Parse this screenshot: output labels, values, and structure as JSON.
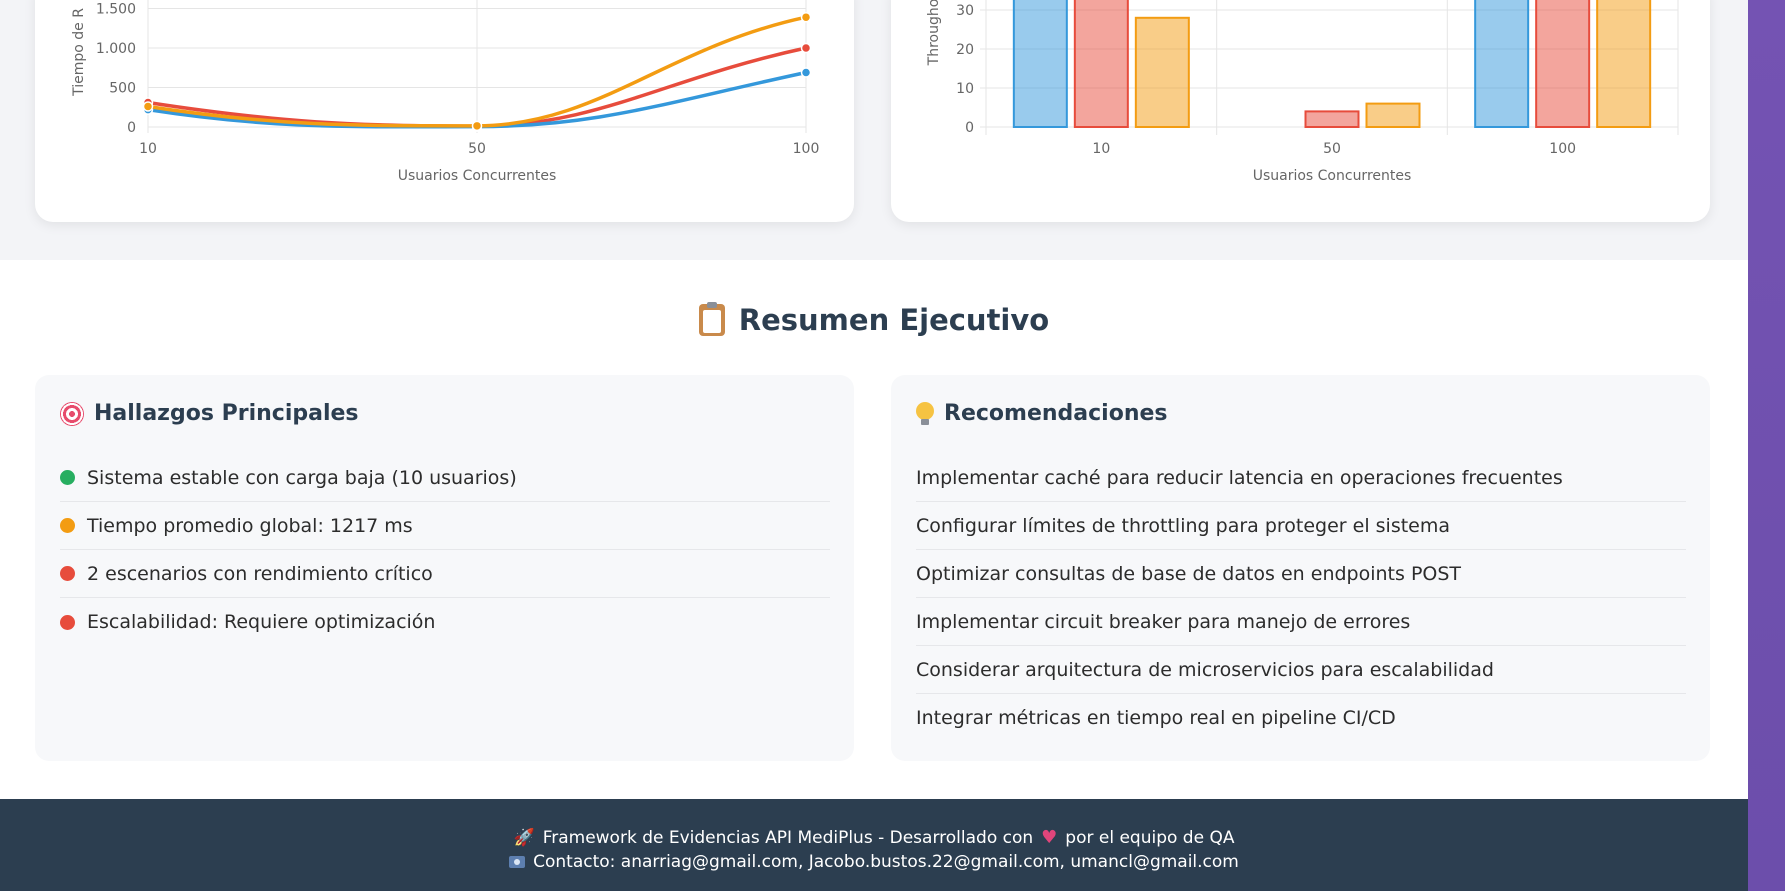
{
  "charts": {
    "response_time": {
      "ylabel_partial": "Tiempo de R",
      "xlabel": "Usuarios Concurrentes",
      "chart_data": {
        "type": "line",
        "x": [
          10,
          50,
          100
        ],
        "ytick_labels": [
          "0",
          "500",
          "1.000",
          "1.500"
        ],
        "yticks": [
          0,
          500,
          1000,
          1500
        ],
        "series": [
          {
            "values": [
              310,
              10,
              1000
            ],
            "color": "#e74c3c"
          },
          {
            "values": [
              220,
              5,
              690
            ],
            "color": "#3498db"
          },
          {
            "values": [
              260,
              15,
              1390
            ],
            "color": "#f39c12"
          }
        ]
      }
    },
    "throughput": {
      "ylabel_partial": "Througho",
      "xlabel": "Usuarios Concurrentes",
      "chart_data": {
        "type": "bar",
        "categories": [
          "10",
          "50",
          "100"
        ],
        "yticks": [
          0,
          10,
          20,
          30
        ],
        "series": [
          {
            "values": [
              40,
              0,
              40
            ],
            "color": "#3498db"
          },
          {
            "values": [
              40,
              4,
              40
            ],
            "color": "#e74c3c"
          },
          {
            "values": [
              28,
              6,
              40
            ],
            "color": "#f39c12"
          }
        ]
      }
    }
  },
  "summary": {
    "title": "Resumen Ejecutivo",
    "findings": {
      "title": "Hallazgos Principales",
      "items": [
        {
          "text": "Sistema estable con carga baja (10 usuarios)",
          "color": "#27ae60"
        },
        {
          "text": "Tiempo promedio global: 1217 ms",
          "color": "#f39c12"
        },
        {
          "text": "2 escenarios con rendimiento crítico",
          "color": "#e74c3c"
        },
        {
          "text": "Escalabilidad: Requiere optimización",
          "color": "#e74c3c"
        }
      ]
    },
    "recommendations": {
      "title": "Recomendaciones",
      "items": [
        "Implementar caché para reducir latencia en operaciones frecuentes",
        "Configurar límites de throttling para proteger el sistema",
        "Optimizar consultas de base de datos en endpoints POST",
        "Implementar circuit breaker para manejo de errores",
        "Considerar arquitectura de microservicios para escalabilidad",
        "Integrar métricas en tiempo real en pipeline CI/CD"
      ]
    }
  },
  "footer": {
    "line1_prefix": "Framework de Evidencias API MediPlus - Desarrollado con",
    "line1_suffix": "por el equipo de QA",
    "line2": "Contacto: anarriag@gmail.com, Jacobo.bustos.22@gmail.com, umancl@gmail.com"
  },
  "icons": {
    "rocket": "rocket-icon",
    "heart": "heart-icon",
    "email": "email-icon",
    "clipboard": "clipboard-icon",
    "target": "target-icon",
    "bulb": "bulb-icon"
  }
}
